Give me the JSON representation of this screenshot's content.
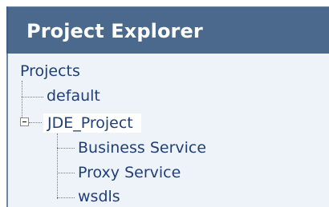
{
  "panel": {
    "title": "Project Explorer"
  },
  "tree": {
    "root": "Projects",
    "nodes": [
      {
        "label": "default"
      },
      {
        "label": "JDE_Project",
        "expanded": true,
        "selected": true,
        "children": [
          {
            "label": "Business Service"
          },
          {
            "label": "Proxy Service"
          },
          {
            "label": "wsdls"
          }
        ]
      }
    ]
  }
}
